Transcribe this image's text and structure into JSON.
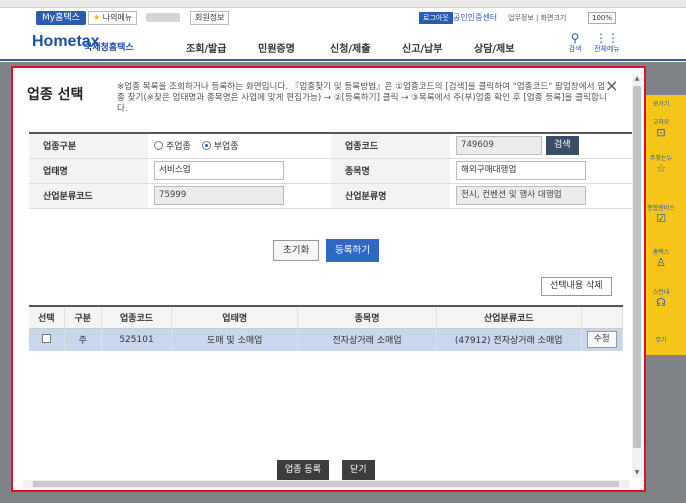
{
  "util": {
    "my_hometax": "My홈택스",
    "my_menu": "나의메뉴",
    "member_info": "회원정보",
    "logout": "로그아웃",
    "certificate": "공인인증센터",
    "links": "업무정보 | 화면크기",
    "zoom": "100%"
  },
  "header": {
    "logo": "Hometax",
    "logo_sub": "국세청홈택스",
    "nav": [
      "조회/발급",
      "민원증명",
      "신청/제출",
      "신고/납부",
      "상담/제보"
    ],
    "search_label": "검색",
    "allmenu_label": "전체메뉴"
  },
  "quick": {
    "items": [
      "로가기",
      "고하오",
      "주찾는뉴",
      "종합엔비스",
      "홈택스",
      "스안내",
      "무기"
    ]
  },
  "modal": {
    "title": "업종 선택",
    "description": "※업종 목록을 조회하거나 등록하는 화면입니다. 『업종찾기 및 등록방법』은 ①업종코드의 [검색]을 클릭하여 \"업종코드\" 팝업창에서 업종 찾기(※찾은 업태명과 종목명은 사업에 맞게 편집가능) → ②[등록하기] 클릭 → ③목록에서 주(부)업종 확인 후 [업종 등록]을 클릭합니다.",
    "close": "×",
    "form": {
      "type_label": "업종구분",
      "type_options": [
        "주업종",
        "부업종"
      ],
      "type_selected": "부업종",
      "code_label": "업종코드",
      "code_value": "749609",
      "search_button": "검색",
      "business_label": "업태명",
      "business_value": "서비스업",
      "item_label": "종목명",
      "item_value": "해외구매대행업",
      "industry_code_label": "산업분류코드",
      "industry_code_value": "75999",
      "industry_name_label": "산업분류명",
      "industry_name_value": "전시, 컨벤션 및 행사 대행업"
    },
    "reset_button": "초기화",
    "register_button": "등록하기",
    "delete_selected_button": "선택내용 삭제",
    "table": {
      "headers": [
        "선택",
        "구분",
        "업종코드",
        "업태명",
        "종목명",
        "산업분류코드"
      ],
      "rows": [
        {
          "kind": "주",
          "code": "525101",
          "business": "도매 및 소매업",
          "item": "전자상거래 소매업",
          "industry": "(47912) 전자상거래 소매업",
          "edit": "수정"
        }
      ]
    },
    "register_industry_button": "업종 등록",
    "close_button": "닫기"
  },
  "colors": {
    "brand": "#2a5bb0",
    "modal_border": "#e0102a",
    "selected_row": "#c8d6ee",
    "primary_button": "#2f69c4"
  }
}
